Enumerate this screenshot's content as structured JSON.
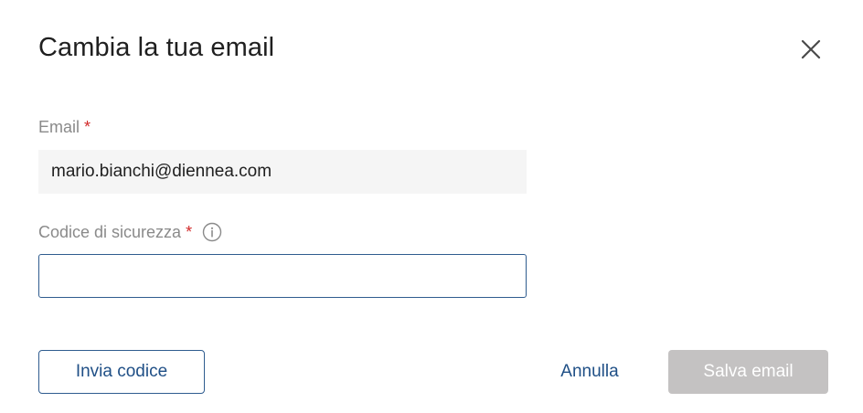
{
  "dialog": {
    "title": "Cambia la tua email",
    "close_icon": "close-icon"
  },
  "email": {
    "label": "Email",
    "required_mark": "*",
    "value": "mario.bianchi@diennea.com"
  },
  "security_code": {
    "label": "Codice di sicurezza",
    "required_mark": "*",
    "info_icon": "info-icon",
    "value": "",
    "placeholder": ""
  },
  "actions": {
    "send_code_label": "Invia codice",
    "cancel_label": "Annulla",
    "save_label": "Salva email",
    "save_disabled": true
  },
  "colors": {
    "accent": "#1f4f86",
    "required": "#d22a2a",
    "disabled_button": "#c4c2c2",
    "readonly_field_bg": "#f5f5f5"
  }
}
